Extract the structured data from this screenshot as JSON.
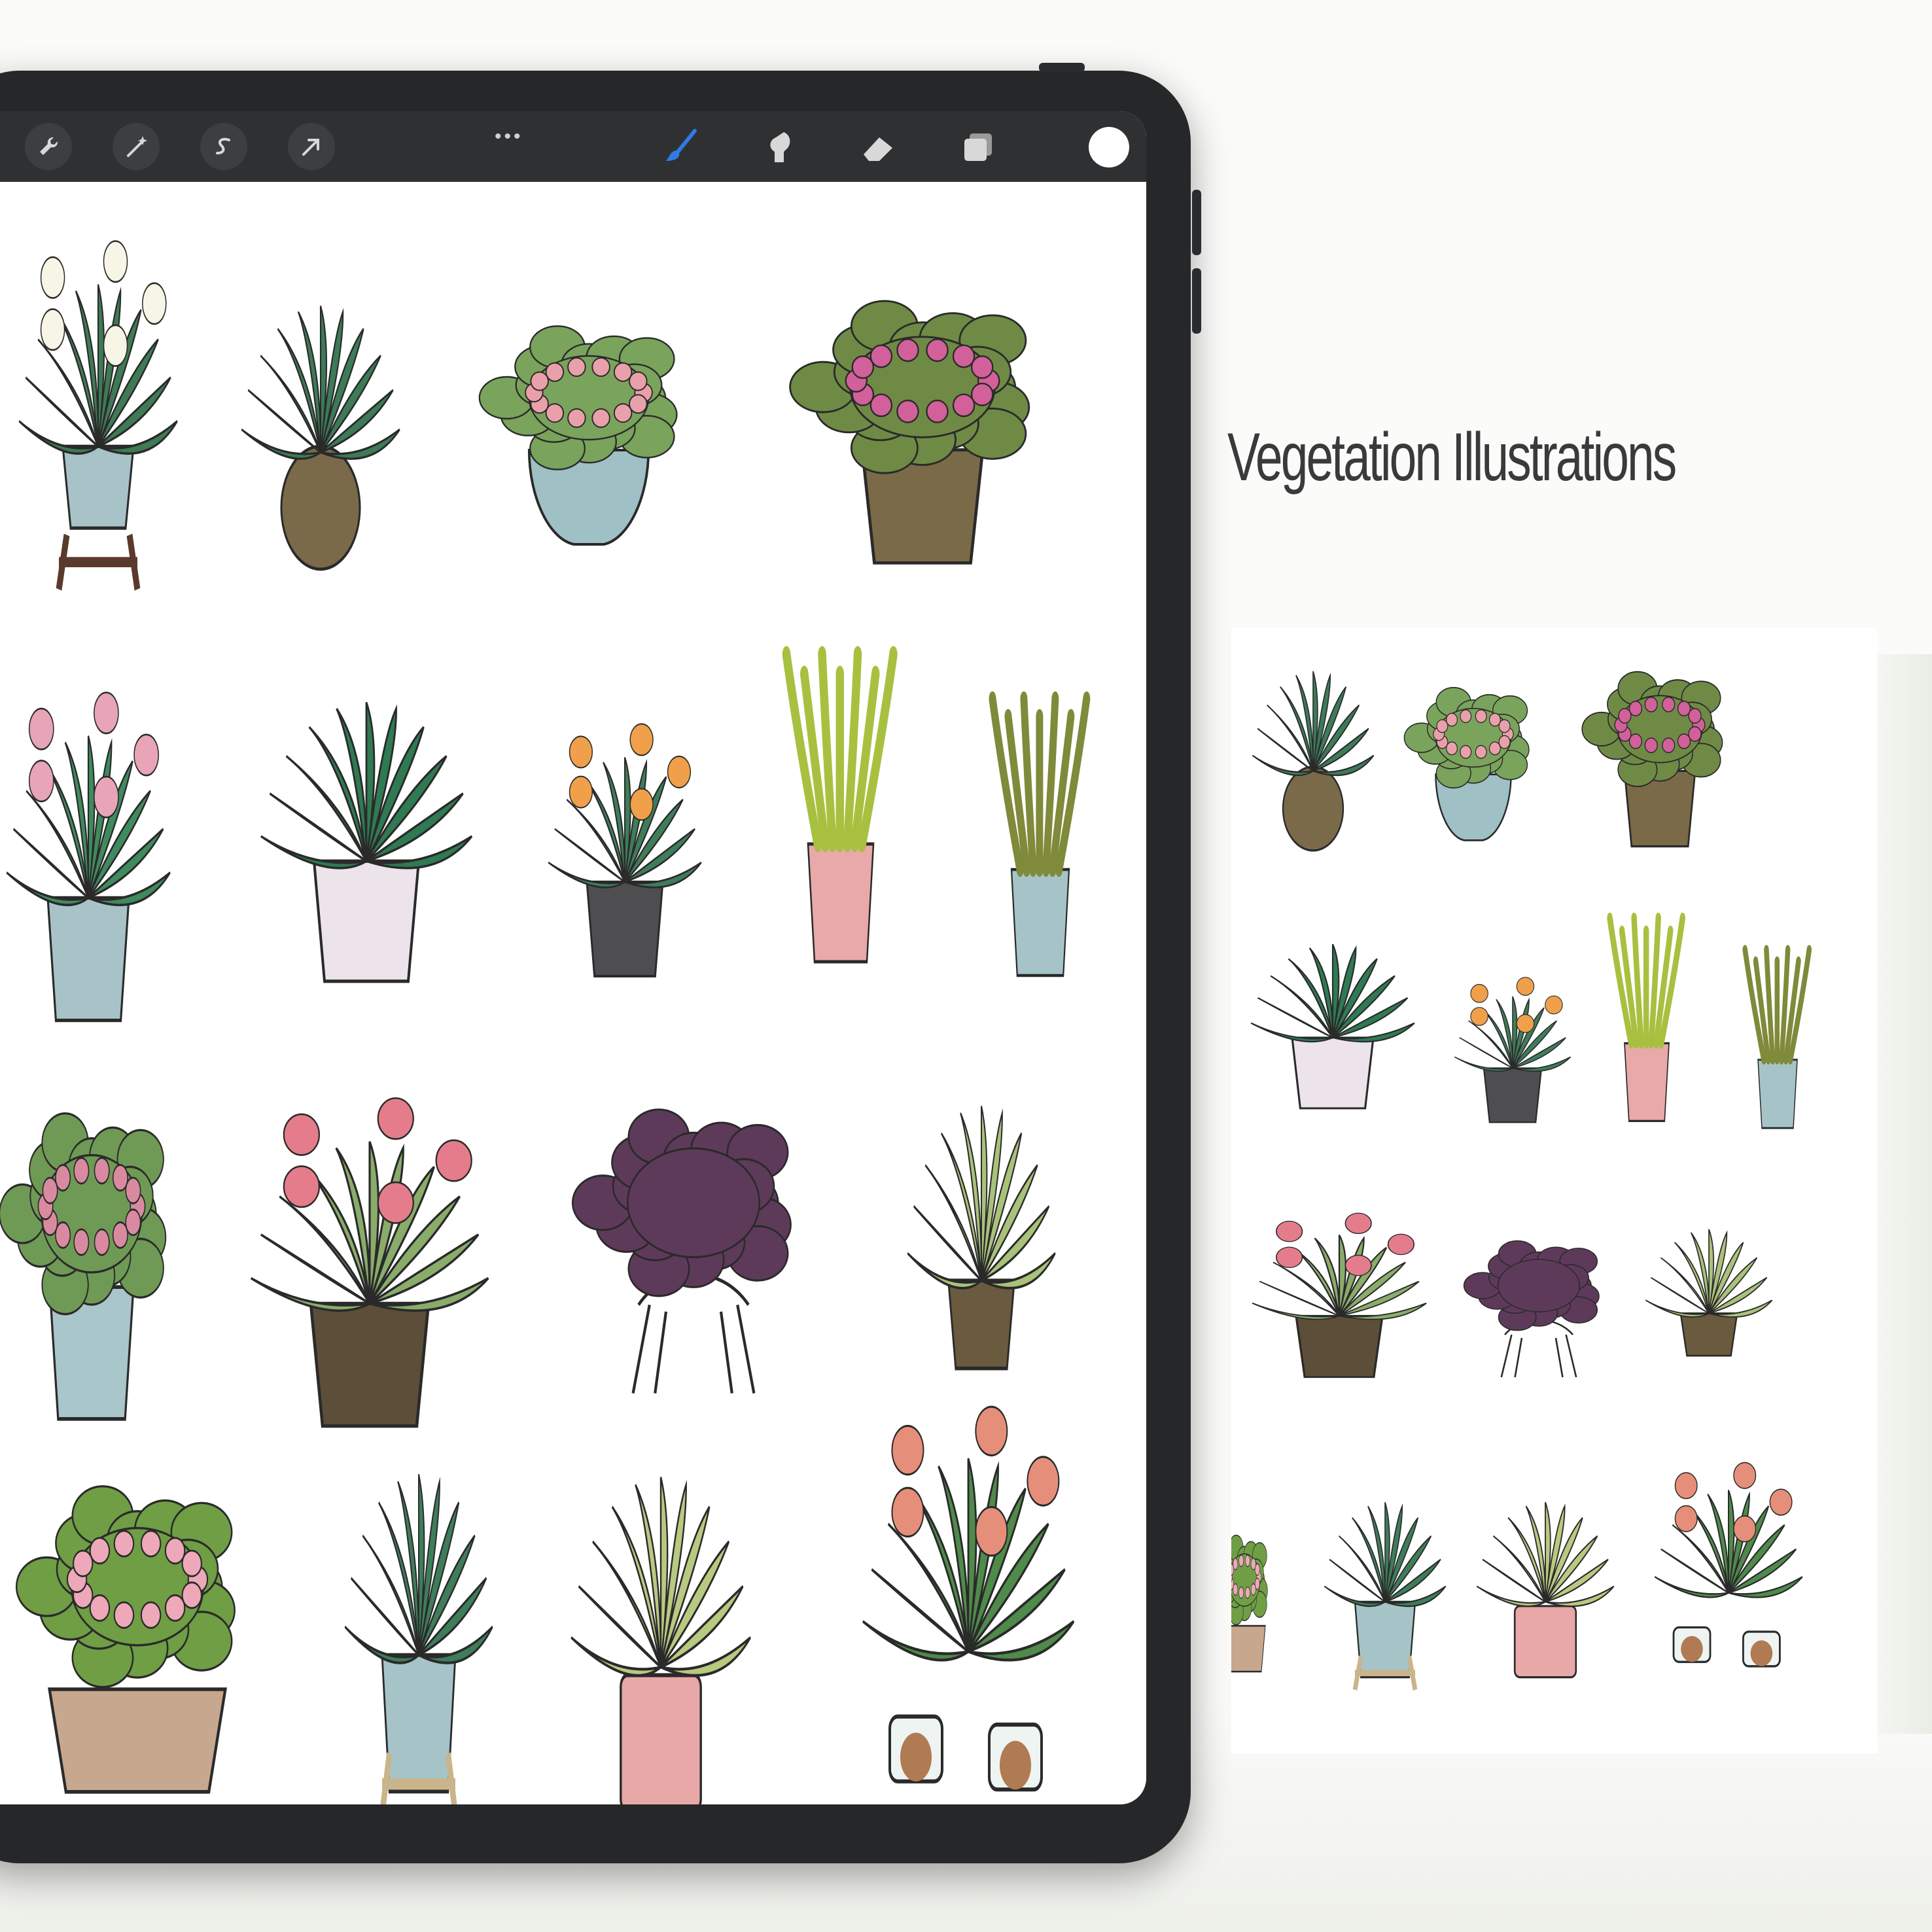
{
  "app": {
    "toolbar_left_tools": [
      {
        "icon": "wrench-icon",
        "name": "actions"
      },
      {
        "icon": "magic-wand-icon",
        "name": "adjustments"
      },
      {
        "icon": "selection-icon",
        "name": "selection"
      },
      {
        "icon": "transform-arrow-icon",
        "name": "transform"
      }
    ],
    "more_label": "•••",
    "toolbar_right_tools": [
      {
        "icon": "brush-icon",
        "name": "brush",
        "active": true
      },
      {
        "icon": "smudge-icon",
        "name": "smudge"
      },
      {
        "icon": "eraser-icon",
        "name": "eraser"
      },
      {
        "icon": "layers-icon",
        "name": "layers"
      }
    ],
    "current_color": "#ffffff",
    "accent_color": "#2f7ae5"
  },
  "canvas": {
    "plants": [
      "peace-lily",
      "calathea",
      "begonia",
      "pink-flower-bush",
      "cyclamen",
      "philodendron",
      "calathea-crocata",
      "dracaena",
      "snake-plant",
      "kalanchoe",
      "african-violet",
      "oxalis",
      "aglaonema",
      "geranium",
      "monstera",
      "ficus-elastica",
      "amaryllis"
    ]
  },
  "preview": {
    "title": "Vegetation Illustrations"
  }
}
